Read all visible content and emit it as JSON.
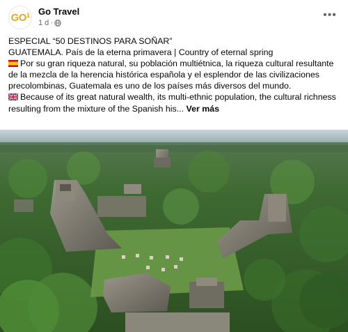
{
  "post": {
    "page_name": "Go Travel",
    "avatar_text": "GO",
    "avatar_superscript": "1",
    "timestamp": "1 d",
    "separator": "·",
    "more_label": "•••"
  },
  "content": {
    "title": "ESPECIAL “50 DESTINOS PARA SOÑAR”",
    "subtitle": "GUATEMALA. País de la eterna primavera | Country of eternal spring",
    "spanish_text": "Por su gran riqueza natural, su población multiétnica, la riqueza cultural resultante de la mezcla de la herencia histórica española y el esplendor de las civilizaciones precolombinas, Guatemala es uno de los países más diversos del mundo.",
    "english_text": "Because of its great natural wealth, its multi-ethnic population, the cultural richness resulting from the mixture of the Spanish his...",
    "see_more_label": "Ver más"
  },
  "icons": {
    "globe": "globe-icon",
    "spain_flag": "spain-flag-icon",
    "uk_flag": "uk-flag-icon",
    "more": "more-options-icon"
  },
  "colors": {
    "avatar_brand": "#e9a825",
    "meta_text": "#65676b"
  }
}
